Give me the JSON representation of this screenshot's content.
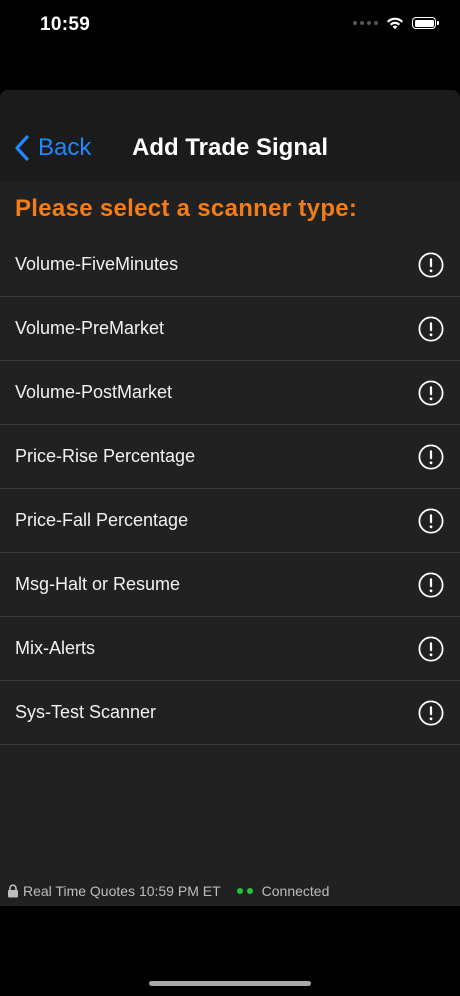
{
  "status_bar": {
    "time": "10:59"
  },
  "nav": {
    "back_label": "Back",
    "title": "Add Trade Signal"
  },
  "prompt": "Please select a scanner type:",
  "scanners": [
    {
      "label": "Volume-FiveMinutes"
    },
    {
      "label": "Volume-PreMarket"
    },
    {
      "label": "Volume-PostMarket"
    },
    {
      "label": "Price-Rise Percentage"
    },
    {
      "label": "Price-Fall Percentage"
    },
    {
      "label": "Msg-Halt or Resume"
    },
    {
      "label": "Mix-Alerts"
    },
    {
      "label": "Sys-Test Scanner"
    }
  ],
  "footer": {
    "quotes_text": "Real Time Quotes 10:59  PM ET",
    "connection_text": "Connected"
  },
  "colors": {
    "accent_orange": "#f07d1a",
    "back_blue": "#1e88ff",
    "connected_green": "#22c53a"
  },
  "icons": {
    "back": "chevron-left-icon",
    "info": "exclamation-circle-icon",
    "lock": "lock-icon",
    "wifi": "wifi-icon",
    "battery": "battery-icon"
  }
}
